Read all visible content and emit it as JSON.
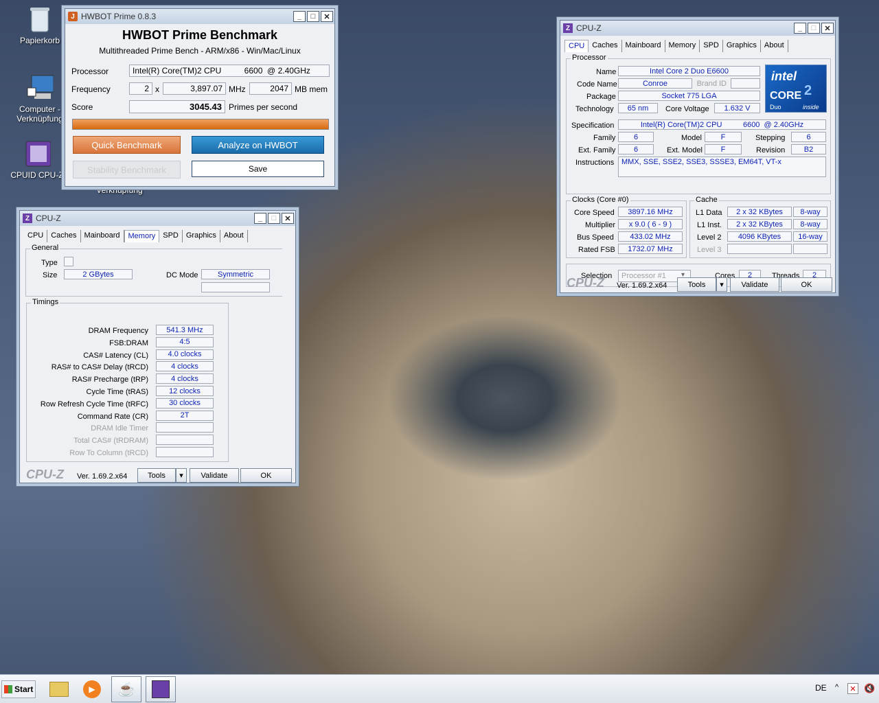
{
  "desktop": {
    "icons": [
      "Papierkorb",
      "Computer - Verknüpfung",
      "CPUID CPU-Z",
      "Verknüpfung"
    ]
  },
  "hwbot": {
    "window_title": "HWBOT Prime 0.8.3",
    "heading": "HWBOT Prime Benchmark",
    "subheading": "Multithreaded Prime Bench - ARM/x86 - Win/Mac/Linux",
    "processor_label": "Processor",
    "processor_value": "Intel(R) Core(TM)2 CPU          6600  @ 2.40GHz",
    "frequency_label": "Frequency",
    "cores": "2",
    "x": "x",
    "frequency": "3,897.07",
    "mhz": "MHz",
    "mem": "2047",
    "mb_mem": "MB mem",
    "score_label": "Score",
    "score": "3045.43",
    "score_unit": "Primes per second",
    "progress": 1.0,
    "quick_btn": "Quick Benchmark",
    "analyze_btn": "Analyze on HWBOT",
    "stability_btn": "Stability Benchmark",
    "save_btn": "Save"
  },
  "cpuz_mem": {
    "window_title": "CPU-Z",
    "tabs": [
      "CPU",
      "Caches",
      "Mainboard",
      "Memory",
      "SPD",
      "Graphics",
      "About"
    ],
    "active_tab": "Memory",
    "general_title": "General",
    "type_label": "Type",
    "type_value": "",
    "size_label": "Size",
    "size_value": "2 GBytes",
    "dc_mode_label": "DC Mode",
    "dc_mode_value": "Symmetric",
    "timings_title": "Timings",
    "timings": [
      {
        "label": "DRAM Frequency",
        "value": "541.3 MHz"
      },
      {
        "label": "FSB:DRAM",
        "value": "4:5"
      },
      {
        "label": "CAS# Latency (CL)",
        "value": "4.0 clocks"
      },
      {
        "label": "RAS# to CAS# Delay (tRCD)",
        "value": "4 clocks"
      },
      {
        "label": "RAS# Precharge (tRP)",
        "value": "4 clocks"
      },
      {
        "label": "Cycle Time (tRAS)",
        "value": "12 clocks"
      },
      {
        "label": "Row Refresh Cycle Time (tRFC)",
        "value": "30 clocks"
      },
      {
        "label": "Command Rate (CR)",
        "value": "2T"
      },
      {
        "label": "DRAM Idle Timer",
        "value": ""
      },
      {
        "label": "Total CAS# (tRDRAM)",
        "value": ""
      },
      {
        "label": "Row To Column (tRCD)",
        "value": ""
      }
    ],
    "brand": "CPU-Z",
    "version": "Ver. 1.69.2.x64",
    "tools": "Tools",
    "validate": "Validate",
    "ok": "OK"
  },
  "cpuz_cpu": {
    "window_title": "CPU-Z",
    "tabs": [
      "CPU",
      "Caches",
      "Mainboard",
      "Memory",
      "SPD",
      "Graphics",
      "About"
    ],
    "active_tab": "CPU",
    "processor_title": "Processor",
    "name_label": "Name",
    "name": "Intel Core 2 Duo E6600",
    "codename_label": "Code Name",
    "codename": "Conroe",
    "brandid_label": "Brand ID",
    "package_label": "Package",
    "package": "Socket 775 LGA",
    "tech_label": "Technology",
    "tech": "65 nm",
    "voltage_label": "Core Voltage",
    "voltage": "1.632 V",
    "spec_label": "Specification",
    "spec": "Intel(R) Core(TM)2 CPU          6600  @ 2.40GHz",
    "family_label": "Family",
    "family": "6",
    "model_label": "Model",
    "model": "F",
    "stepping_label": "Stepping",
    "stepping": "6",
    "extfamily_label": "Ext. Family",
    "extfamily": "6",
    "extmodel_label": "Ext. Model",
    "extmodel": "F",
    "revision_label": "Revision",
    "revision": "B2",
    "instr_label": "Instructions",
    "instr": "MMX, SSE, SSE2, SSE3, SSSE3, EM64T, VT-x",
    "logo": {
      "brand": "intel",
      "line": "CORE",
      "num": "2",
      "sub": "Duo",
      "inside": "inside"
    },
    "clocks_title": "Clocks (Core #0)",
    "corespeed_label": "Core Speed",
    "corespeed": "3897.16 MHz",
    "mult_label": "Multiplier",
    "mult": "x 9.0 ( 6 - 9 )",
    "bus_label": "Bus Speed",
    "bus": "433.02 MHz",
    "fsb_label": "Rated FSB",
    "fsb": "1732.07 MHz",
    "cache_title": "Cache",
    "l1d_label": "L1 Data",
    "l1d": "2 x 32 KBytes",
    "l1d_way": "8-way",
    "l1i_label": "L1 Inst.",
    "l1i": "2 x 32 KBytes",
    "l1i_way": "8-way",
    "l2_label": "Level 2",
    "l2": "4096 KBytes",
    "l2_way": "16-way",
    "l3_label": "Level 3",
    "selection_label": "Selection",
    "selection": "Processor #1",
    "cores_label": "Cores",
    "cores": "2",
    "threads_label": "Threads",
    "threads": "2",
    "brand": "CPU-Z",
    "version": "Ver. 1.69.2.x64",
    "tools": "Tools",
    "validate": "Validate",
    "ok": "OK"
  },
  "taskbar": {
    "start": "Start",
    "lang": "DE"
  }
}
